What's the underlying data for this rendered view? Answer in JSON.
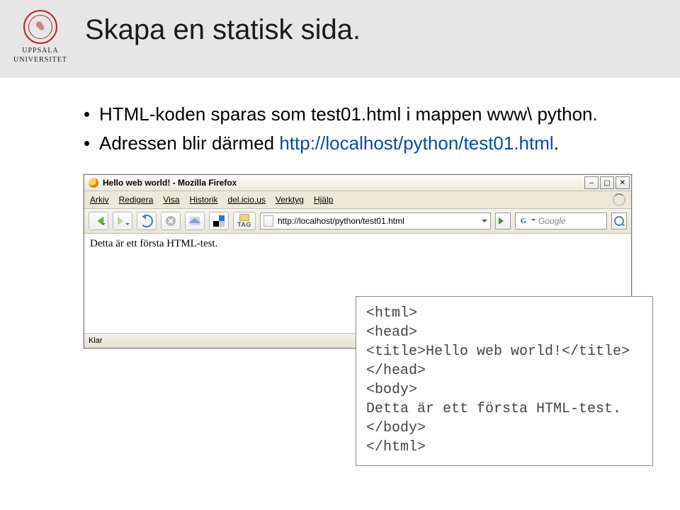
{
  "slide": {
    "title": "Skapa en statisk sida.",
    "university_line1": "UPPSALA",
    "university_line2": "UNIVERSITET"
  },
  "bullets": {
    "b1a": "HTML-koden sparas som test01.html i mappen www\\ python.",
    "b2a": "Adressen blir därmed ",
    "b2link": "http://localhost/python/test01.html",
    "b2b": "."
  },
  "browser": {
    "window_title": "Hello web world! - Mozilla Firefox",
    "menu": {
      "arkiv": "Arkiv",
      "redigera": "Redigera",
      "visa": "Visa",
      "historik": "Historik",
      "delicious": "del.icio.us",
      "verktyg": "Verktyg",
      "hjalp": "Hjälp"
    },
    "tag_label": "TAG",
    "url": "http://localhost/python/test01.html",
    "search_engine": "G",
    "search_placeholder": "Google",
    "page_text": "Detta är ett första HTML-test.",
    "status": "Klar"
  },
  "code": {
    "l1": "<html>",
    "l2": "<head>",
    "l3": "<title>Hello web world!</title>",
    "l4": "</head>",
    "l5": "<body>",
    "l6": "Detta är ett första HTML-test.",
    "l7": "</body>",
    "l8": "</html>"
  }
}
